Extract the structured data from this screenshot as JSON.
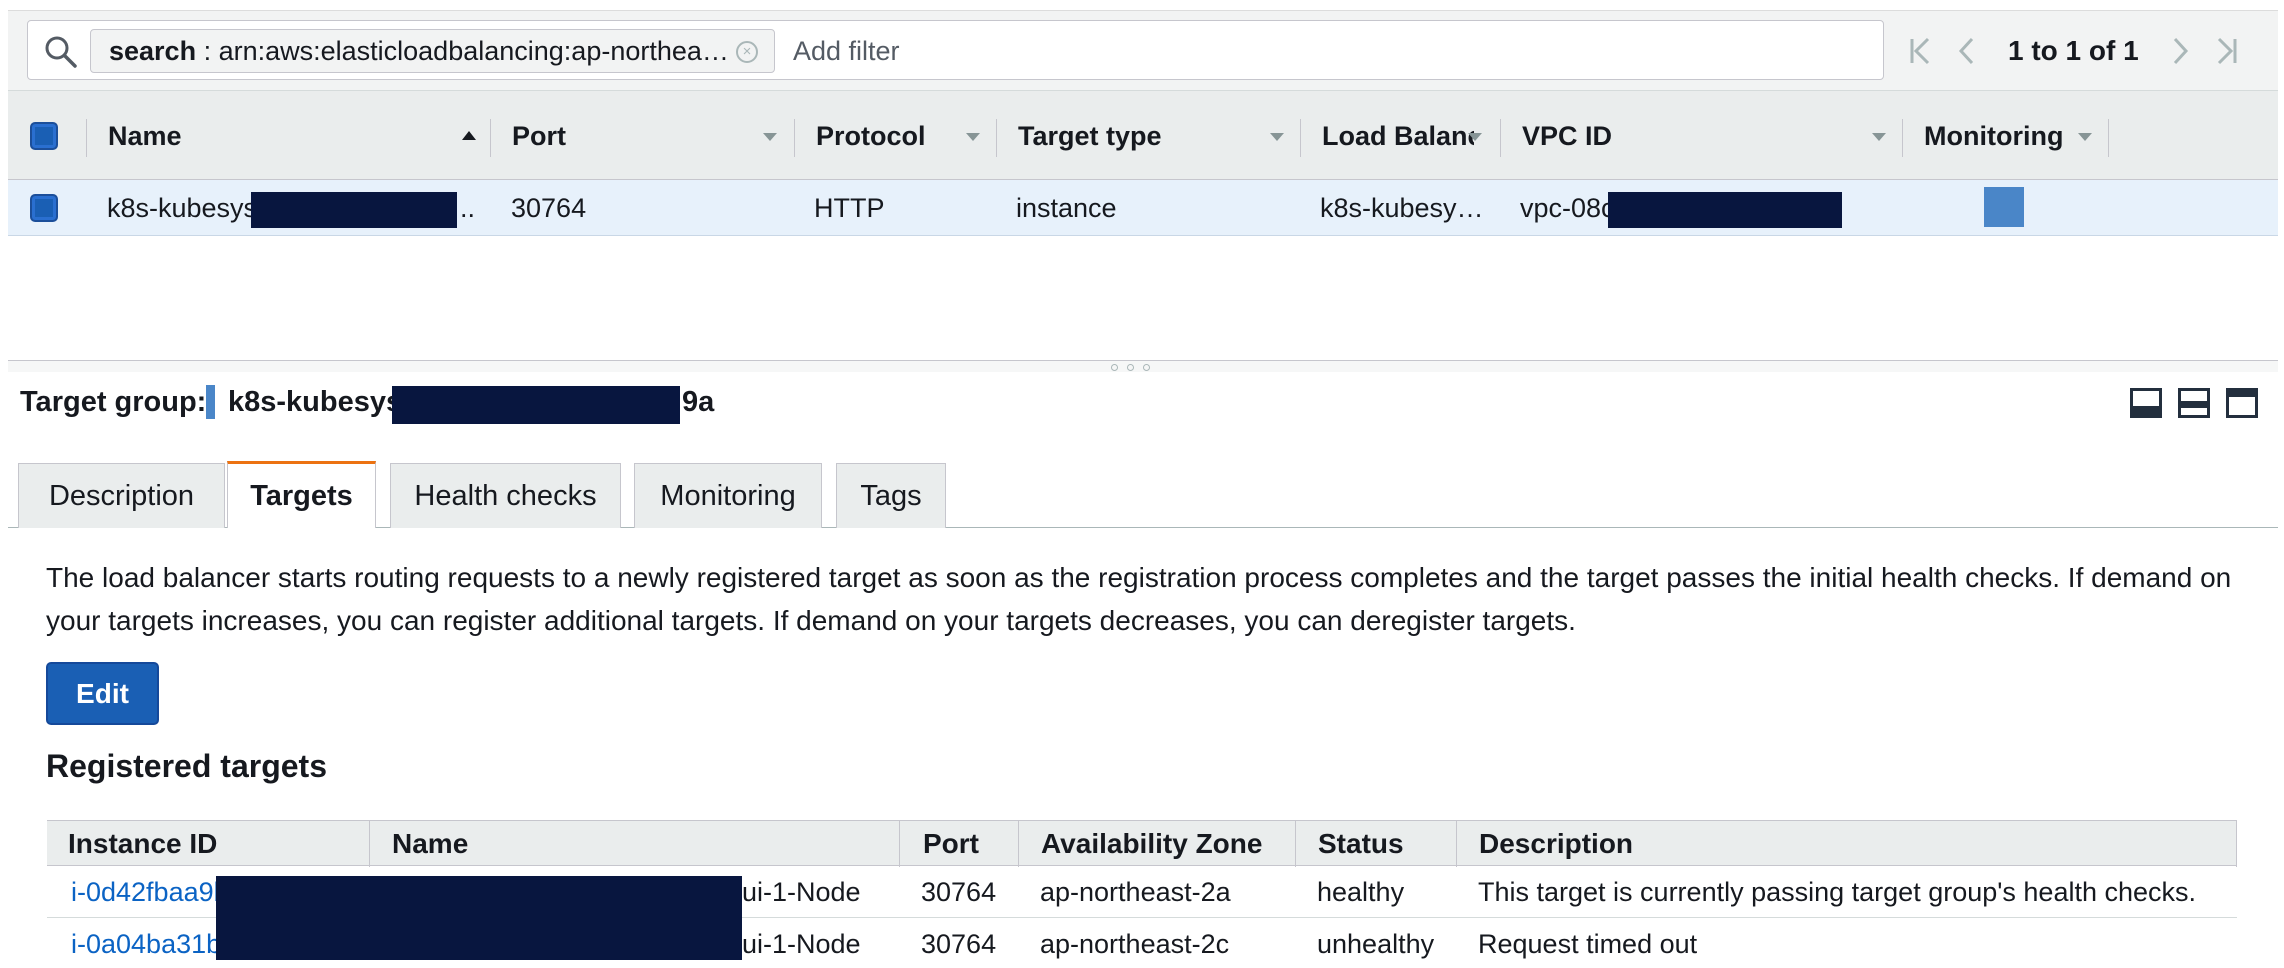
{
  "search": {
    "token_key": "search",
    "token_value": " : arn:aws:elasticloadbalancing:ap-northea…",
    "placeholder": "Add filter"
  },
  "pagination": {
    "text": "1 to 1 of 1"
  },
  "table": {
    "columns": [
      "Name",
      "Port",
      "Protocol",
      "Target type",
      "Load Balancer",
      "VPC ID",
      "Monitoring"
    ],
    "rows": [
      {
        "name_prefix": "k8s-kubesys",
        "name_suffix": "..",
        "port": "30764",
        "protocol": "HTTP",
        "target_type": "instance",
        "load_balancer": "k8s-kubesy…",
        "vpc_id_prefix": "vpc-08c"
      }
    ]
  },
  "detail": {
    "label": "Target group:",
    "name_prefix": "k8s-kubesys",
    "name_suffix": "9a"
  },
  "tabs": [
    "Description",
    "Targets",
    "Health checks",
    "Monitoring",
    "Tags"
  ],
  "active_tab": "Targets",
  "targets": {
    "intro": "The load balancer starts routing requests to a newly registered target as soon as the registration process completes and the target passes the initial health checks. If demand on your targets increases, you can register additional targets. If demand on your targets decreases, you can deregister targets.",
    "edit_label": "Edit",
    "registered_title": "Registered targets",
    "columns": [
      "Instance ID",
      "Name",
      "Port",
      "Availability Zone",
      "Status",
      "Description"
    ],
    "rows": [
      {
        "instance_id": "i-0d42fbaa9b",
        "name_suffix": "ui-1-Node",
        "port": "30764",
        "az": "ap-northeast-2a",
        "status": "healthy",
        "description": "This target is currently passing target group's health checks."
      },
      {
        "instance_id": "i-0a04ba31b",
        "name_suffix": "ui-1-Node",
        "port": "30764",
        "az": "ap-northeast-2c",
        "status": "unhealthy",
        "description": "Request timed out"
      }
    ]
  },
  "colors": {
    "selected_row": "#e7f1fb",
    "primary_button": "#1a5fb4",
    "active_tab_accent": "#ec7211",
    "link": "#0b63c4",
    "redaction": "#08163f"
  }
}
